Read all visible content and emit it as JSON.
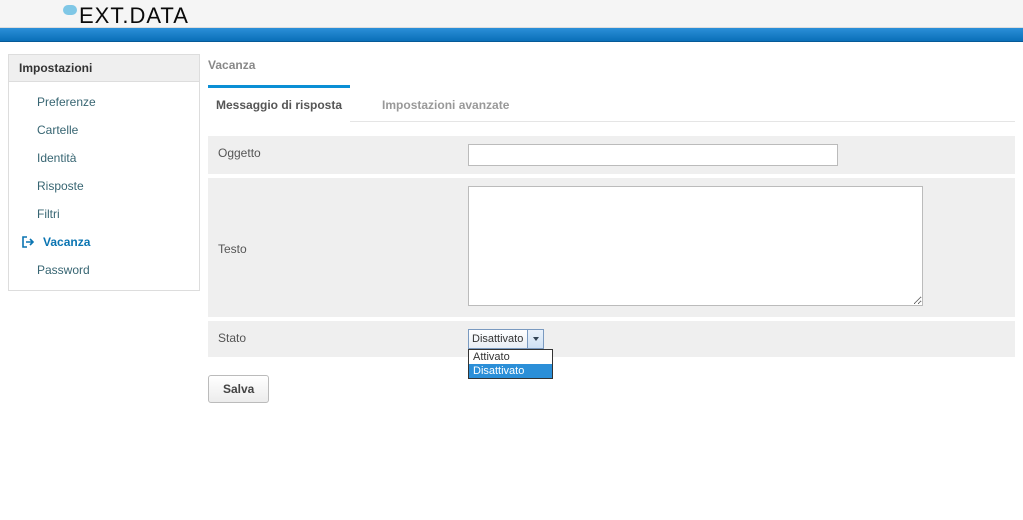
{
  "brand": {
    "name": "EXT.DATA"
  },
  "sidebar": {
    "title": "Impostazioni",
    "items": [
      {
        "label": "Preferenze"
      },
      {
        "label": "Cartelle"
      },
      {
        "label": "Identità"
      },
      {
        "label": "Risposte"
      },
      {
        "label": "Filtri"
      },
      {
        "label": "Vacanza",
        "active": true
      },
      {
        "label": "Password"
      }
    ]
  },
  "content": {
    "title": "Vacanza",
    "tabs": [
      {
        "label": "Messaggio di risposta",
        "active": true
      },
      {
        "label": "Impostazioni avanzate"
      }
    ],
    "fields": {
      "subject_label": "Oggetto",
      "subject_value": "",
      "body_label": "Testo",
      "body_value": "",
      "status_label": "Stato",
      "status_selected": "Disattivato",
      "status_options": [
        "Attivato",
        "Disattivato"
      ],
      "status_highlight_index": 1,
      "save_button": "Salva"
    }
  }
}
